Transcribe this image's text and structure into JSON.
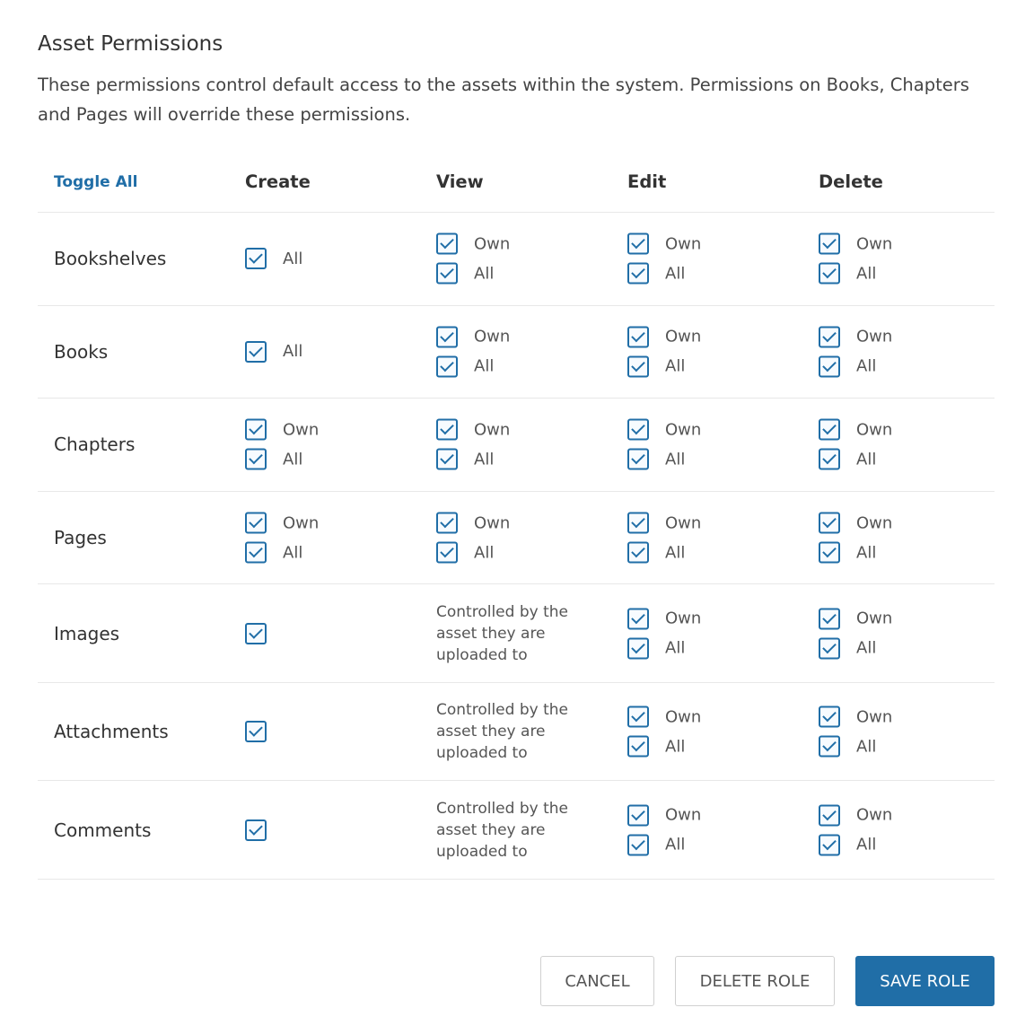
{
  "section": {
    "title": "Asset Permissions",
    "description": "These permissions control default access to the assets within the system. Permissions on Books, Chapters and Pages will override these permissions."
  },
  "table": {
    "toggle_all": "Toggle All",
    "columns": [
      "Create",
      "View",
      "Edit",
      "Delete"
    ],
    "option_labels": {
      "own": "Own",
      "all": "All"
    },
    "controlled_note": "Controlled by the asset they are uploaded to",
    "rows": [
      {
        "label": "Bookshelves",
        "create": [
          "All"
        ],
        "view": [
          "Own",
          "All"
        ],
        "edit": [
          "Own",
          "All"
        ],
        "delete": [
          "Own",
          "All"
        ]
      },
      {
        "label": "Books",
        "create": [
          "All"
        ],
        "view": [
          "Own",
          "All"
        ],
        "edit": [
          "Own",
          "All"
        ],
        "delete": [
          "Own",
          "All"
        ]
      },
      {
        "label": "Chapters",
        "create": [
          "Own",
          "All"
        ],
        "view": [
          "Own",
          "All"
        ],
        "edit": [
          "Own",
          "All"
        ],
        "delete": [
          "Own",
          "All"
        ]
      },
      {
        "label": "Pages",
        "create": [
          "Own",
          "All"
        ],
        "view": [
          "Own",
          "All"
        ],
        "edit": [
          "Own",
          "All"
        ],
        "delete": [
          "Own",
          "All"
        ]
      },
      {
        "label": "Images",
        "create": [
          ""
        ],
        "view": "note",
        "edit": [
          "Own",
          "All"
        ],
        "delete": [
          "Own",
          "All"
        ]
      },
      {
        "label": "Attachments",
        "create": [
          ""
        ],
        "view": "note",
        "edit": [
          "Own",
          "All"
        ],
        "delete": [
          "Own",
          "All"
        ]
      },
      {
        "label": "Comments",
        "create": [
          ""
        ],
        "view": "note",
        "edit": [
          "Own",
          "All"
        ],
        "delete": [
          "Own",
          "All"
        ]
      }
    ]
  },
  "actions": {
    "cancel": "CANCEL",
    "delete_role": "DELETE ROLE",
    "save_role": "SAVE ROLE"
  },
  "colors": {
    "accent": "#206ea7",
    "border": "#e8e8e8"
  }
}
